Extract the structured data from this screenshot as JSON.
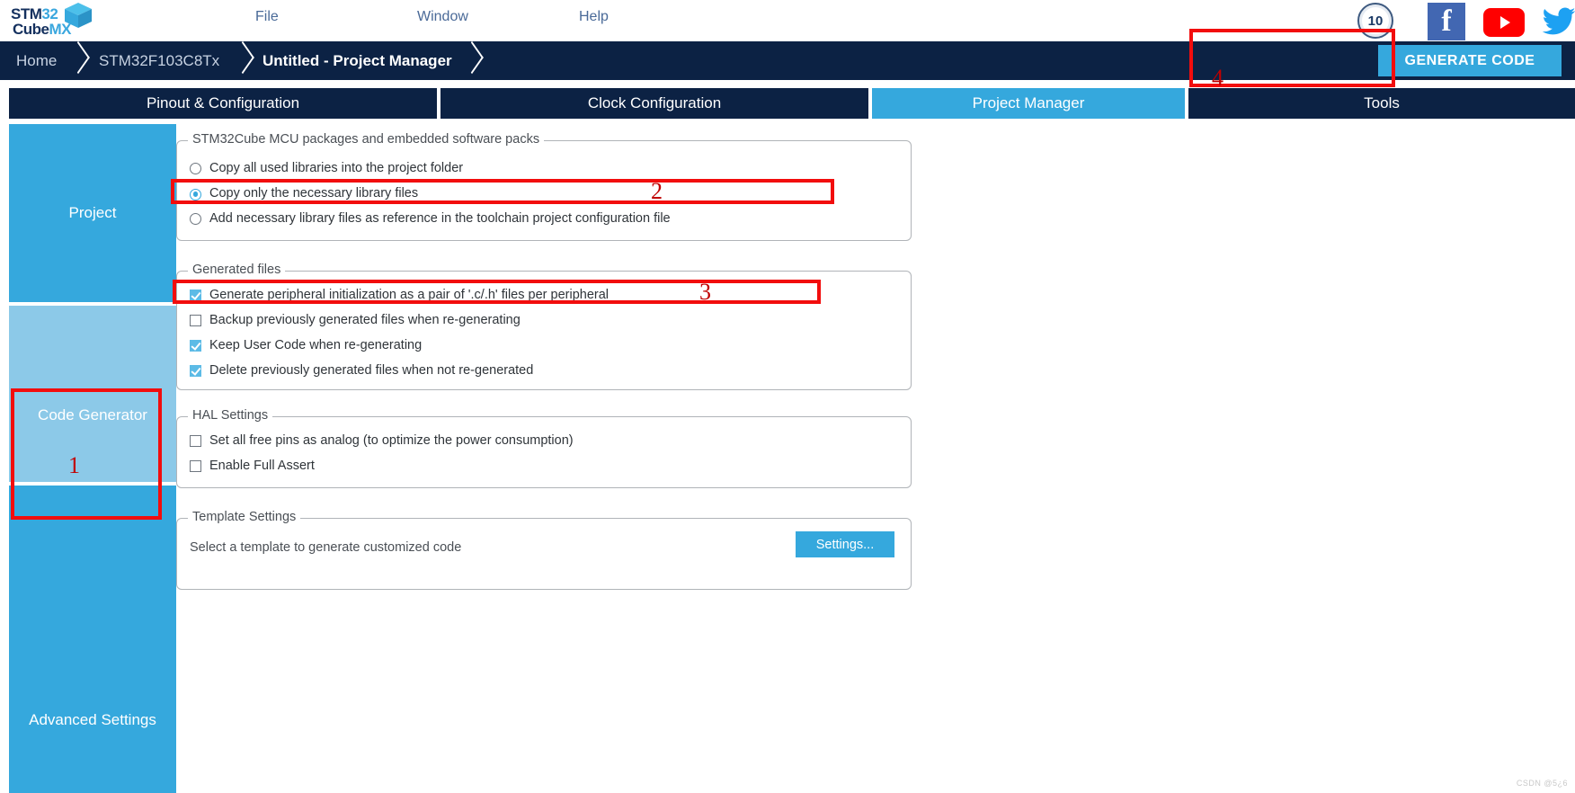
{
  "app": {
    "logo_top": "STM32",
    "logo_top_num": "32",
    "logo_bottom": "CubeMX",
    "watermark": "CSDN @5¿6"
  },
  "menubar": {
    "items": [
      {
        "label": "File"
      },
      {
        "label": "Window"
      },
      {
        "label": "Help"
      }
    ],
    "social": [
      {
        "name": "anniversary-10-badge",
        "label": "10"
      },
      {
        "name": "facebook-icon",
        "label": "f"
      },
      {
        "name": "youtube-icon",
        "label": ""
      },
      {
        "name": "twitter-icon",
        "label": ""
      }
    ]
  },
  "breadcrumb": {
    "items": [
      {
        "label": "Home",
        "active": false
      },
      {
        "label": "STM32F103C8Tx",
        "active": false
      },
      {
        "label": "Untitled - Project Manager",
        "active": true
      }
    ]
  },
  "toolbar": {
    "generate_code_label": "GENERATE CODE"
  },
  "tabs": [
    {
      "label": "Pinout & Configuration",
      "selected": false
    },
    {
      "label": "Clock Configuration",
      "selected": false
    },
    {
      "label": "Project Manager",
      "selected": true
    },
    {
      "label": "Tools",
      "selected": false
    }
  ],
  "sidebar": {
    "items": [
      {
        "label": "Project",
        "selected": false
      },
      {
        "label": "Code Generator",
        "selected": true
      },
      {
        "label": "Advanced Settings",
        "selected": false
      }
    ]
  },
  "groups": {
    "packs": {
      "title": "STM32Cube MCU packages and embedded software packs",
      "options": [
        {
          "label": "Copy all used libraries into the project folder",
          "checked": false,
          "focused": false
        },
        {
          "label": "Copy only the necessary library files",
          "checked": true,
          "focused": true
        },
        {
          "label": "Add necessary library files as reference in the toolchain project configuration file",
          "checked": false,
          "focused": false
        }
      ]
    },
    "generated_files": {
      "title": "Generated files",
      "options": [
        {
          "label": "Generate peripheral initialization as a pair of '.c/.h' files per peripheral",
          "checked": true
        },
        {
          "label": "Backup previously generated files when re-generating",
          "checked": false
        },
        {
          "label": "Keep User Code when re-generating",
          "checked": true
        },
        {
          "label": "Delete previously generated files when not re-generated",
          "checked": true
        }
      ]
    },
    "hal_settings": {
      "title": "HAL Settings",
      "options": [
        {
          "label": "Set all free pins as analog (to optimize the power consumption)",
          "checked": false
        },
        {
          "label": "Enable Full Assert",
          "checked": false
        }
      ]
    },
    "template_settings": {
      "title": "Template Settings",
      "description": "Select a template to generate customized code",
      "button_label": "Settings..."
    }
  },
  "annotations": [
    {
      "number": "1"
    },
    {
      "number": "2"
    },
    {
      "number": "3"
    },
    {
      "number": "4"
    }
  ],
  "colors": {
    "accent": "#35a8dd",
    "dark_navy": "#0c2244",
    "annotation_red": "#f20d0d",
    "selected_sidebar": "#8cc9e8"
  }
}
